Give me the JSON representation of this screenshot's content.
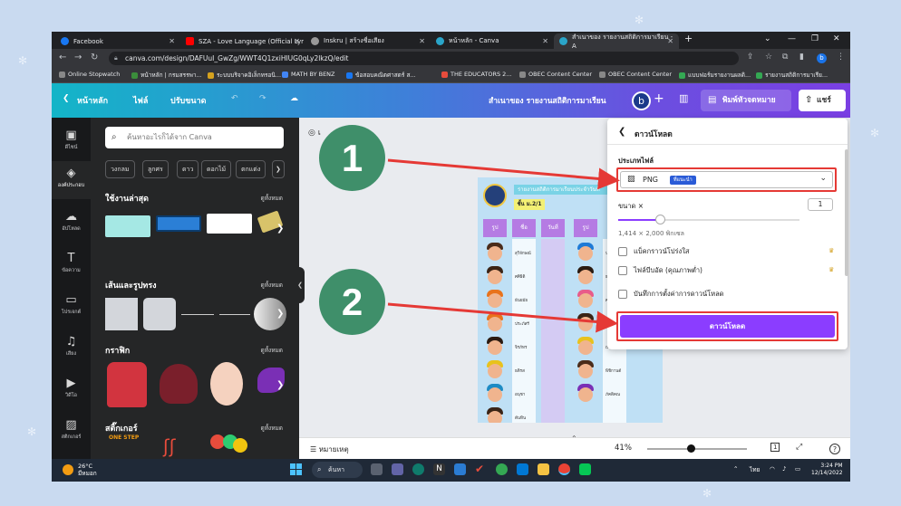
{
  "browser": {
    "tabs": [
      {
        "label": "Facebook",
        "color": "#1877f2"
      },
      {
        "label": "SZA - Love Language (Official Lyr",
        "color": "#ff0000"
      },
      {
        "label": "Inskru | สร้างชื่อเสียง",
        "color": "#999999"
      },
      {
        "label": "หน้าหลัก - Canva",
        "color": "#2aa5c9"
      },
      {
        "label": "สำเนาของ รายงานสถิติการมาเรียน - A",
        "color": "#2aa5c9"
      }
    ],
    "url": "canva.com/design/DAFUuI_GwZg/WWT4Q1zxiHIUG0qLy2lkzQ/edit",
    "bookmarks": [
      "Online Stopwatch",
      "หน้าหลัก | กรมสรรพา...",
      "ระบบบริจาคอิเล็กทรอนิ...",
      "MATH BY BENZ",
      "ข้อสอบคณิตศาสตร์ ส...",
      "THE EDUCATORS 2...",
      "OBEC Content Center",
      "OBEC Content Center",
      "แบบฟอร์มรายงานผลดิ...",
      "รายงานสถิติการมาเรีย..."
    ]
  },
  "header": {
    "home": "หน้าหลัก",
    "file": "ไฟล์",
    "resize": "ปรับขนาด",
    "title": "สำเนาของ รายงานสถิติการมาเรียน",
    "avatar_letter": "b",
    "print": "พิมพ์หัวจดหมาย",
    "share": "แชร์"
  },
  "iconbar": [
    {
      "label": "ดีไซน์",
      "icon": "layout-icon"
    },
    {
      "label": "องค์ประกอบ",
      "icon": "elements-icon"
    },
    {
      "label": "อัปโหลด",
      "icon": "upload-icon"
    },
    {
      "label": "ข้อความ",
      "icon": "text-icon"
    },
    {
      "label": "โปรเจกต์",
      "icon": "folder-icon"
    },
    {
      "label": "เสียง",
      "icon": "music-icon"
    },
    {
      "label": "วิดีโอ",
      "icon": "video-icon"
    },
    {
      "label": "สติกเกอร์",
      "icon": "pattern-icon"
    }
  ],
  "panel": {
    "search_placeholder": "ค้นหาอะไรก็ได้จาก Canva",
    "chips": [
      "วงกลม",
      "ลูกศร",
      "ดาว",
      "ดอกไม้",
      "ตกแต่ง"
    ],
    "sections": [
      {
        "title": "ใช้งานล่าสุด",
        "all": "ดูทั้งหมด"
      },
      {
        "title": "เส้นและรูปทรง",
        "all": "ดูทั้งหมด"
      },
      {
        "title": "กราฟิก",
        "all": "ดูทั้งหมด"
      },
      {
        "title": "สติ๊กเกอร์",
        "all": "ดูทั้งหมด"
      }
    ],
    "sticker_text": "ONE STEP"
  },
  "doc": {
    "title": "รายงานสถิติการมาเรียนประจำวันที่",
    "class": "ชั้น ม.2/1",
    "headers": [
      "รูป",
      "ชื่อ",
      "วันที่",
      "รูป"
    ],
    "names": [
      "สุวิจักษณ์",
      "ศศิธิดิ",
      "ธันยมัย",
      "ประภัสรี",
      "จิรภัทร",
      "ธติรส",
      "อนุชา",
      "ต้นทิน"
    ],
    "names_right": [
      "ปริลาวดี",
      "ธรรศชนก",
      "ศรัณญา",
      "ลูกปัด",
      "ณัฐกานต์",
      "พิชิกานต์",
      "ภัคติคณ"
    ]
  },
  "bottom": {
    "notes": "หมายเหตุ",
    "zoom": "41%",
    "page": "1"
  },
  "download": {
    "title": "ดาวน์โหลด",
    "filetype_label": "ประเภทไฟล์",
    "filetype_value": "PNG",
    "recommended": "ที่แนะนำ",
    "size_label": "ขนาด ×",
    "size_value": "1",
    "size_fraction": 0.23,
    "dims": "1,414 × 2,000 พิกเซล",
    "options": [
      "แบ็คกราวน์โปร่งใส",
      "ไฟล์บีบอัด (คุณภาพต่ำ)",
      "บันทึกการตั้งค่าการดาวน์โหลด"
    ],
    "button": "ดาวน์โหลด"
  },
  "callouts": [
    "1",
    "2"
  ],
  "taskbar": {
    "temp": "26°C",
    "weather": "มีหมอก",
    "search": "ค้นหา",
    "lang": "ไทย",
    "time": "3:24 PM",
    "date": "12/14/2022"
  },
  "colors": {
    "accent": "#8b3dff",
    "highlight": "#e53935",
    "callout": "#3f8f6a"
  }
}
